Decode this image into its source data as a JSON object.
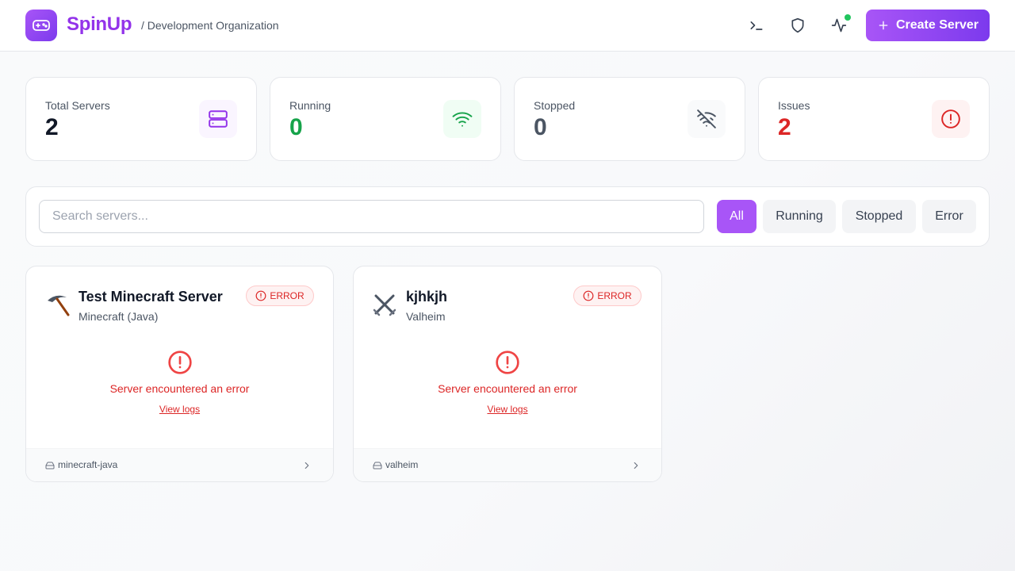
{
  "header": {
    "brand": "SpinUp",
    "org": "/ Development Organization",
    "create_label": "Create Server",
    "status_color": "#22c55e",
    "icons": [
      "terminal-icon",
      "shield-icon",
      "activity-icon"
    ]
  },
  "stats": [
    {
      "label": "Total Servers",
      "value": "2",
      "color": "#111827",
      "icon": "server-icon"
    },
    {
      "label": "Running",
      "value": "0",
      "color": "#16a34a",
      "icon": "wifi-icon"
    },
    {
      "label": "Stopped",
      "value": "0",
      "color": "#4b5563",
      "icon": "wifi-off-icon"
    },
    {
      "label": "Issues",
      "value": "2",
      "color": "#dc2626",
      "icon": "alert-circle-icon"
    }
  ],
  "search": {
    "placeholder": "Search servers...",
    "value": ""
  },
  "filters": [
    {
      "label": "All",
      "active": true
    },
    {
      "label": "Running",
      "active": false
    },
    {
      "label": "Stopped",
      "active": false
    },
    {
      "label": "Error",
      "active": false
    }
  ],
  "servers": [
    {
      "name": "Test Minecraft Server",
      "game": "Minecraft (Java)",
      "status": "ERROR",
      "icon": "pickaxe-icon",
      "message": "Server encountered an error",
      "logs_label": "View logs",
      "image": "minecraft-java"
    },
    {
      "name": "kjhkjh",
      "game": "Valheim",
      "status": "ERROR",
      "icon": "crossed-swords-icon",
      "message": "Server encountered an error",
      "logs_label": "View logs",
      "image": "valheim"
    }
  ],
  "colors": {
    "accent": "#a855f7",
    "error": "#dc2626",
    "success": "#16a34a"
  }
}
